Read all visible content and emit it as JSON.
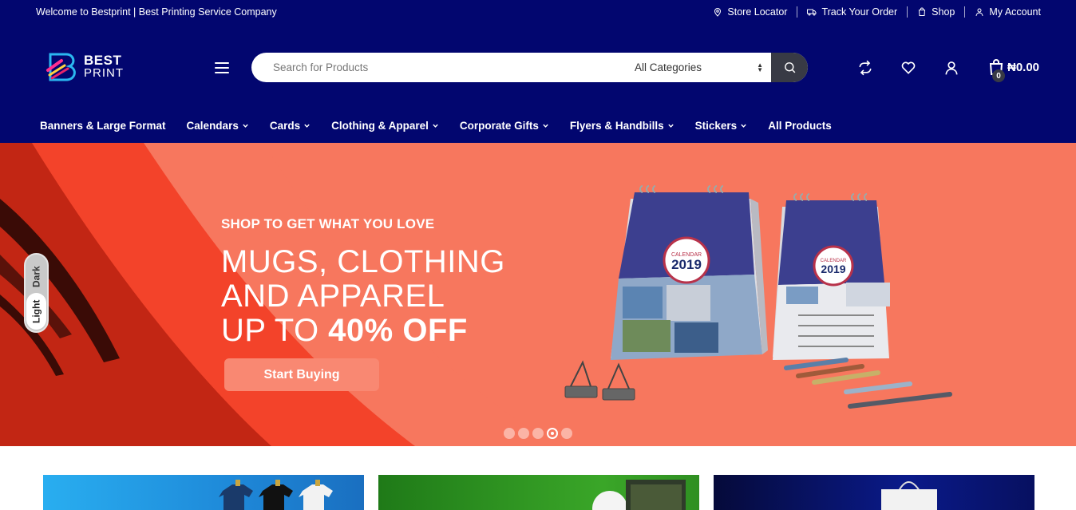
{
  "topbar": {
    "welcome": "Welcome to Bestprint | Best Printing Service Company",
    "links": [
      {
        "label": "Store Locator",
        "icon": "location-pin-icon"
      },
      {
        "label": "Track Your Order",
        "icon": "truck-icon"
      },
      {
        "label": "Shop",
        "icon": "shopping-bag-icon"
      },
      {
        "label": "My Account",
        "icon": "user-icon"
      }
    ]
  },
  "header": {
    "logo_line1": "BEST",
    "logo_line2": "PRINT",
    "search_placeholder": "Search for Products",
    "category_selected": "All Categories",
    "cart_count": "0",
    "cart_total": "₦0.00"
  },
  "nav": {
    "items": [
      {
        "label": "Banners & Large Format",
        "dropdown": false
      },
      {
        "label": "Calendars",
        "dropdown": true
      },
      {
        "label": "Cards",
        "dropdown": true
      },
      {
        "label": "Clothing & Apparel",
        "dropdown": true
      },
      {
        "label": "Corporate Gifts",
        "dropdown": true
      },
      {
        "label": "Flyers & Handbills",
        "dropdown": true
      },
      {
        "label": "Stickers",
        "dropdown": true
      },
      {
        "label": "All Products",
        "dropdown": false
      }
    ]
  },
  "hero": {
    "subtitle": "SHOP TO GET WHAT YOU LOVE",
    "line1": "MUGS, CLOTHING",
    "line2": "AND APPAREL",
    "line3_prefix": "UP TO ",
    "line3_bold": "40% OFF",
    "cta": "Start Buying",
    "calendar_badge": "CALENDAR",
    "calendar_year": "2019",
    "slide_count": 5,
    "active_slide": 4
  },
  "theme_toggle": {
    "dark_label": "Dark",
    "light_label": "Light"
  },
  "colors": {
    "header_bg": "#02066f",
    "hero_bg": "#f7775e",
    "accent_dark": "#383a45"
  }
}
